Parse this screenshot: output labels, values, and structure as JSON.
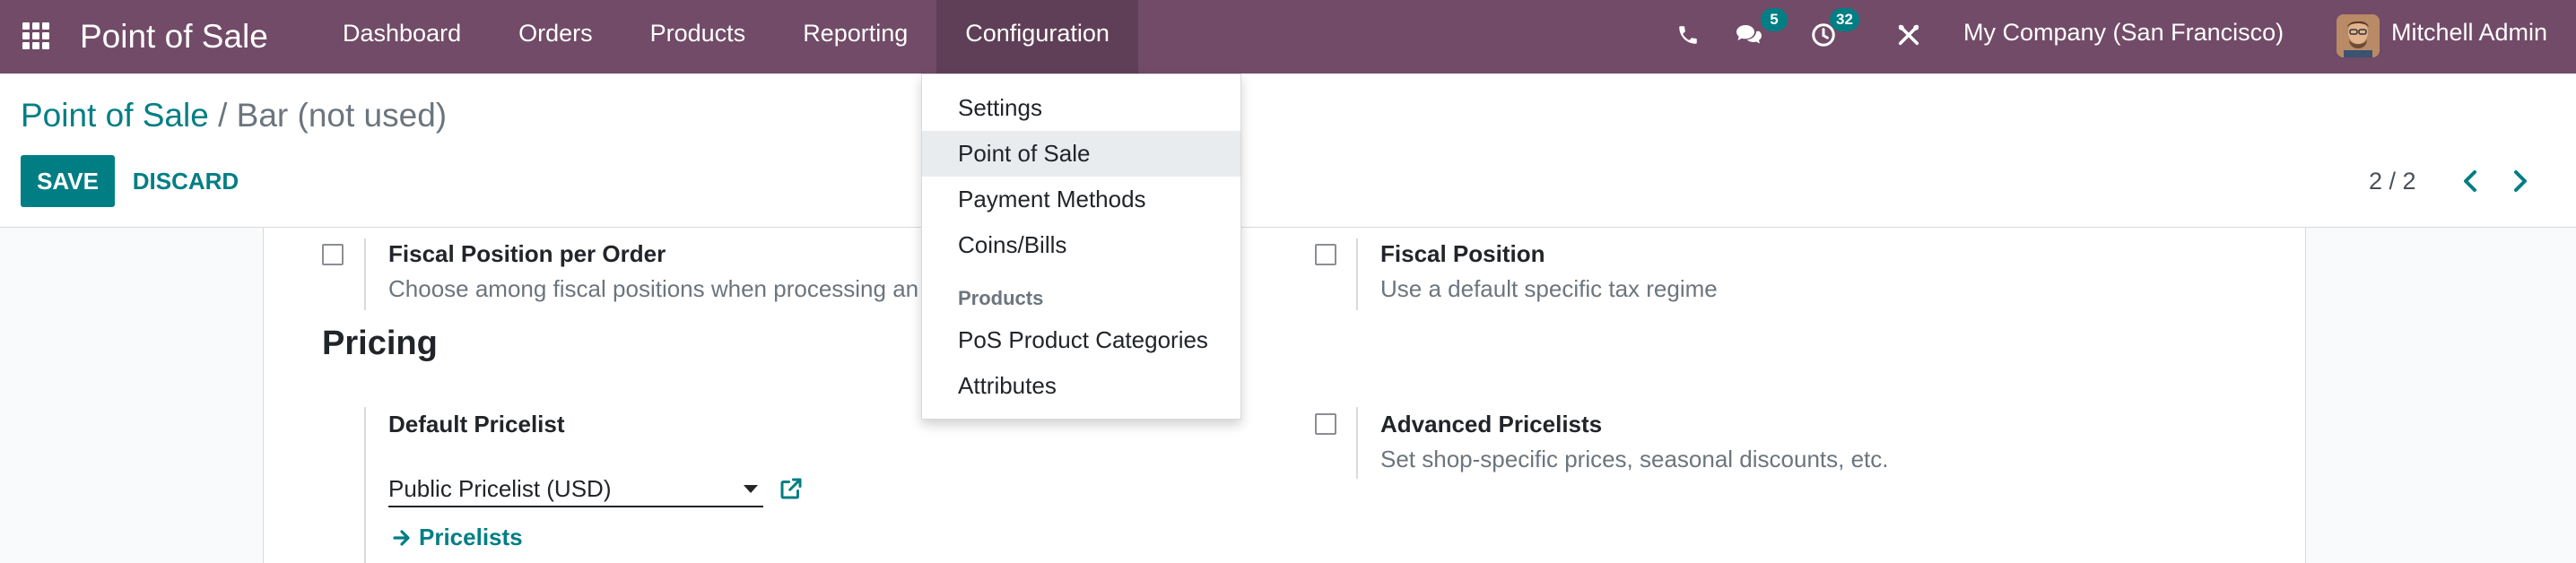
{
  "navbar": {
    "app_name": "Point of Sale",
    "menu": [
      "Dashboard",
      "Orders",
      "Products",
      "Reporting",
      "Configuration"
    ],
    "active_menu": "Configuration",
    "messages_badge": "5",
    "activities_badge": "32",
    "company": "My Company (San Francisco)",
    "user": "Mitchell Admin"
  },
  "breadcrumb": {
    "parent": "Point of Sale",
    "separator": "/",
    "current": "Bar (not used)"
  },
  "actions": {
    "save": "SAVE",
    "discard": "DISCARD"
  },
  "pager": {
    "value": "2 / 2"
  },
  "settings": {
    "fiscal_position_per_order": {
      "title": "Fiscal Position per Order",
      "desc": "Choose among fiscal positions when processing an"
    },
    "fiscal_position": {
      "title": "Fiscal Position",
      "desc": "Use a default specific tax regime"
    },
    "pricing_section": "Pricing",
    "default_pricelist": {
      "title": "Default Pricelist",
      "value": "Public Pricelist (USD)",
      "link": "Pricelists"
    },
    "advanced_pricelists": {
      "title": "Advanced Pricelists",
      "desc": "Set shop-specific prices, seasonal discounts, etc."
    }
  },
  "dropdown": {
    "items_top": [
      "Settings",
      "Point of Sale",
      "Payment Methods",
      "Coins/Bills"
    ],
    "highlighted": "Point of Sale",
    "section_header": "Products",
    "items_products": [
      "PoS Product Categories",
      "Attributes"
    ]
  },
  "colors": {
    "navbar": "#714b67",
    "primary": "#017e84"
  },
  "icons": [
    "apps-grid-icon",
    "phone-icon",
    "chat-icon",
    "clock-icon",
    "tools-icon",
    "chevron-left-icon",
    "chevron-right-icon",
    "external-link-icon",
    "arrow-right-icon"
  ]
}
